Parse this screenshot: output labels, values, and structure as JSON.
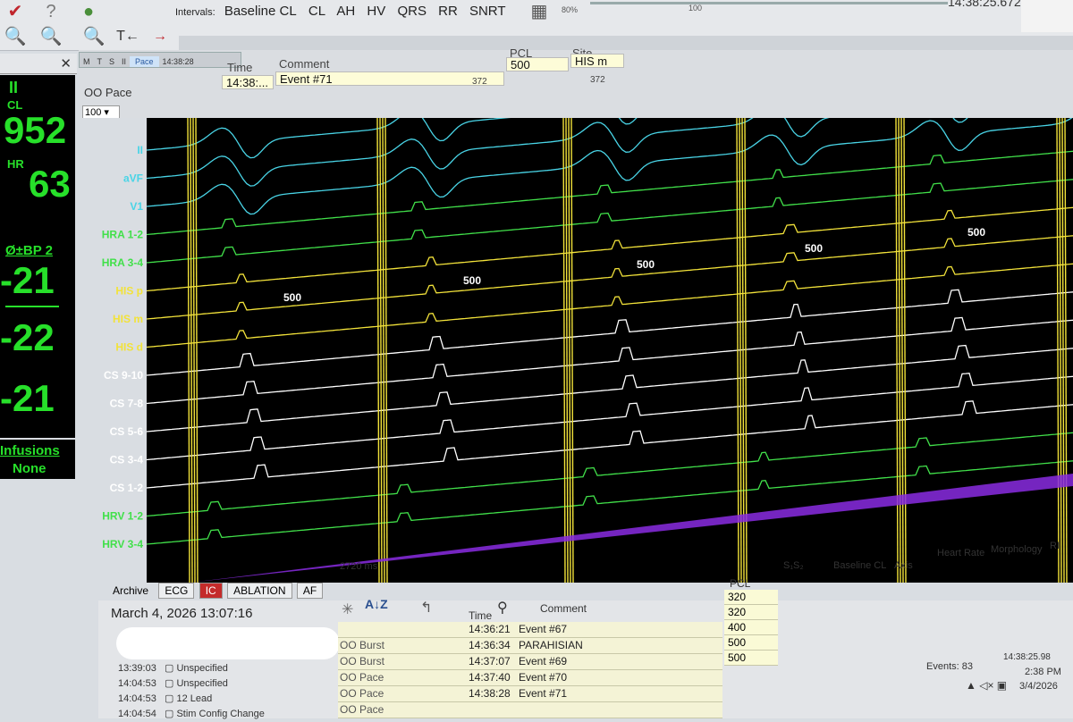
{
  "toolbar": {
    "intervals_label": "Intervals:",
    "intervals": [
      "Baseline CL",
      "CL",
      "AH",
      "HV",
      "QRS",
      "RR",
      "SNRT"
    ],
    "zoom_pct": "80%",
    "slider_value": "100",
    "top_time": "14:38:25.672",
    "icons": [
      "checkmark-icon",
      "help-icon",
      "paint-icon",
      "zoom-s-icon",
      "zoom-w-icon",
      "zoom-t-icon",
      "caliper-t-icon",
      "arrow-icon",
      "grid-icon"
    ]
  },
  "vitals": {
    "lead": "II",
    "cl_label": "CL",
    "cl_value": "952",
    "hr_label": "HR",
    "hr_value": "63",
    "bp_label": "Ø±BP 2",
    "bp_values": [
      "-21",
      "-22",
      "-21"
    ],
    "infusions_label": "Infusions",
    "infusions_value": "None"
  },
  "header": {
    "tabs": [
      "M",
      "T",
      "S",
      "II"
    ],
    "active_tab": "Pace",
    "active_time": "14:38:28",
    "time_col": "Time",
    "comment_col": "Comment",
    "pcl_col": "PCL",
    "site_col": "Site",
    "time_val": "14:38:...",
    "comment_val": "Event #71",
    "pcl_val": "500",
    "site_val": "HIS m",
    "pace_label": "OO Pace",
    "zoom": "100",
    "markers": [
      "372",
      "372"
    ]
  },
  "channels": [
    {
      "name": "II",
      "color": "#49d4e6"
    },
    {
      "name": "aVF",
      "color": "#49d4e6"
    },
    {
      "name": "V1",
      "color": "#49d4e6"
    },
    {
      "name": "HRA 1-2",
      "color": "#41e04a"
    },
    {
      "name": "HRA 3-4",
      "color": "#41e04a"
    },
    {
      "name": "HIS p",
      "color": "#f2e23a"
    },
    {
      "name": "HIS m",
      "color": "#f2e23a"
    },
    {
      "name": "HIS d",
      "color": "#f2e23a"
    },
    {
      "name": "CS 9-10",
      "color": "#ffffff"
    },
    {
      "name": "CS 7-8",
      "color": "#ffffff"
    },
    {
      "name": "CS 5-6",
      "color": "#ffffff"
    },
    {
      "name": "CS 3-4",
      "color": "#ffffff"
    },
    {
      "name": "CS 1-2",
      "color": "#ffffff"
    },
    {
      "name": "HRV 1-2",
      "color": "#41e04a"
    },
    {
      "name": "HRV 3-4",
      "color": "#41e04a"
    }
  ],
  "intervals_shown": [
    "500",
    "500",
    "500",
    "500",
    "500"
  ],
  "scale_label": "2720 ms",
  "bottom_tabs": [
    "Archive",
    "ECG",
    "IC",
    "ABLATION",
    "AF"
  ],
  "active_bottom_tab": "IC",
  "date_time": "March 4, 2026  13:07:16",
  "event_header": {
    "time": "Time",
    "comment": "Comment",
    "pcl": "PCL"
  },
  "events": [
    {
      "type": "",
      "time": "14:36:21",
      "comment": "Event #67",
      "pcl": "320"
    },
    {
      "type": "OO Burst",
      "time": "14:36:34",
      "comment": "PARAHISIAN",
      "pcl": "320"
    },
    {
      "type": "OO Burst",
      "time": "14:37:07",
      "comment": "Event #69",
      "pcl": "400"
    },
    {
      "type": "OO Pace",
      "time": "14:37:40",
      "comment": "Event #70",
      "pcl": "500"
    },
    {
      "type": "OO Pace",
      "time": "14:38:28",
      "comment": "Event #71",
      "pcl": "500"
    },
    {
      "type": "OO Pace",
      "time": "",
      "comment": "",
      "pcl": ""
    }
  ],
  "metrics_cols": [
    "S₁S₂",
    "Baseline CL",
    "Axis",
    "Heart Rate",
    "Morphology",
    "RI"
  ],
  "log": [
    {
      "time": "13:39:03",
      "text": "Unspecified"
    },
    {
      "time": "14:04:53",
      "text": "Unspecified"
    },
    {
      "time": "14:04:53",
      "text": "12 Lead"
    },
    {
      "time": "14:04:54",
      "text": "Stim Config Change"
    }
  ],
  "status": {
    "events_label": "Events: 83",
    "right_time": "14:38:25.98",
    "clock": "2:38 PM",
    "date": "3/4/2026"
  }
}
